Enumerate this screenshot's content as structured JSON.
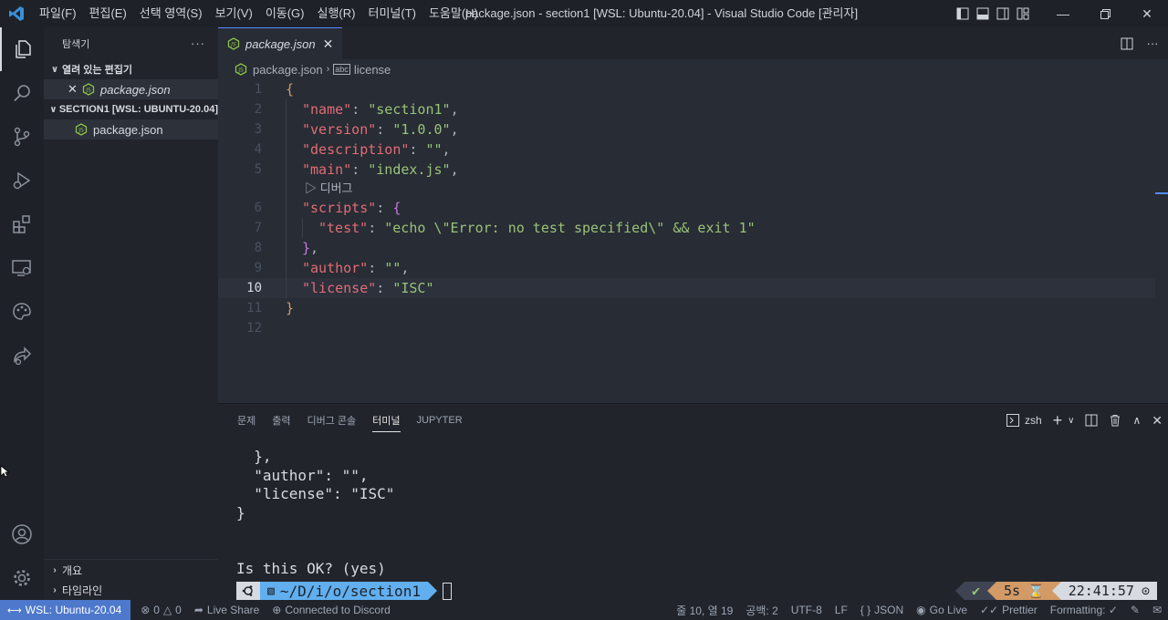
{
  "window": {
    "title": "package.json - section1 [WSL: Ubuntu-20.04] - Visual Studio Code [관리자]",
    "menu": [
      "파일(F)",
      "편집(E)",
      "선택 영역(S)",
      "보기(V)",
      "이동(G)",
      "실행(R)",
      "터미널(T)",
      "도움말(H)"
    ]
  },
  "sidebar": {
    "title": "탐색기",
    "more": "···",
    "open_editors": {
      "label": "열려 있는 편집기",
      "items": [
        {
          "name": "package.json"
        }
      ]
    },
    "folder": {
      "label": "SECTION1 [WSL: UBUNTU-20.04]",
      "items": [
        {
          "name": "package.json"
        }
      ]
    },
    "outline_label": "개요",
    "timeline_label": "타임라인"
  },
  "editor": {
    "tab_label": "package.json",
    "breadcrumb": [
      "package.json",
      "license"
    ],
    "codelens": "디버그",
    "current_line": 10,
    "lines": [
      {
        "n": "1",
        "tokens": [
          [
            "b1",
            "{"
          ]
        ]
      },
      {
        "n": "2",
        "tokens": [
          [
            "k",
            "\"name\""
          ],
          [
            "p",
            ": "
          ],
          [
            "s",
            "\"section1\""
          ],
          [
            "p",
            ","
          ]
        ]
      },
      {
        "n": "3",
        "tokens": [
          [
            "k",
            "\"version\""
          ],
          [
            "p",
            ": "
          ],
          [
            "s",
            "\"1.0.0\""
          ],
          [
            "p",
            ","
          ]
        ]
      },
      {
        "n": "4",
        "tokens": [
          [
            "k",
            "\"description\""
          ],
          [
            "p",
            ": "
          ],
          [
            "s",
            "\"\""
          ],
          [
            "p",
            ","
          ]
        ]
      },
      {
        "n": "5",
        "tokens": [
          [
            "k",
            "\"main\""
          ],
          [
            "p",
            ": "
          ],
          [
            "s",
            "\"index.js\""
          ],
          [
            "p",
            ","
          ]
        ]
      },
      {
        "n": "6",
        "tokens": [
          [
            "k",
            "\"scripts\""
          ],
          [
            "p",
            ": "
          ],
          [
            "b2",
            "{"
          ]
        ]
      },
      {
        "n": "7",
        "tokens": [
          [
            "k",
            "\"test\""
          ],
          [
            "p",
            ": "
          ],
          [
            "s",
            "\"echo \\\"Error: no test specified\\\" && exit 1\""
          ]
        ]
      },
      {
        "n": "8",
        "tokens": [
          [
            "b2",
            "}"
          ],
          [
            "p",
            ","
          ]
        ]
      },
      {
        "n": "9",
        "tokens": [
          [
            "k",
            "\"author\""
          ],
          [
            "p",
            ": "
          ],
          [
            "s",
            "\"\""
          ],
          [
            "p",
            ","
          ]
        ]
      },
      {
        "n": "10",
        "tokens": [
          [
            "k",
            "\"license\""
          ],
          [
            "p",
            ": "
          ],
          [
            "s",
            "\"ISC\""
          ]
        ]
      },
      {
        "n": "11",
        "tokens": [
          [
            "b1",
            "}"
          ]
        ]
      },
      {
        "n": "12",
        "tokens": []
      }
    ]
  },
  "panel": {
    "tabs": [
      "문제",
      "출력",
      "디버그 콘솔",
      "터미널",
      "JUPYTER"
    ],
    "active_tab": "터미널",
    "shell": "zsh",
    "terminal_lines": [
      "  },",
      "  \"author\": \"\",",
      "  \"license\": \"ISC\"",
      "}",
      "",
      "",
      "Is this OK? (yes)"
    ],
    "prompt": {
      "path": "~/D/i/o/section1",
      "duration": "5s",
      "time": "22:41:57"
    }
  },
  "statusbar": {
    "remote": "WSL: Ubuntu-20.04",
    "errors": "0",
    "warnings": "0",
    "live_share": "Live Share",
    "discord": "Connected to Discord",
    "position": "줄 10, 열 19",
    "indent": "공백: 2",
    "encoding": "UTF-8",
    "eol": "LF",
    "language": "JSON",
    "go_live": "Go Live",
    "prettier": "Prettier",
    "formatting": "Formatting: ✓"
  },
  "colors": {
    "accent": "#528bff",
    "remote_bg": "#4d78cc",
    "key": "#e06c75",
    "string": "#98c379",
    "json_icon": "#8bc34a"
  }
}
